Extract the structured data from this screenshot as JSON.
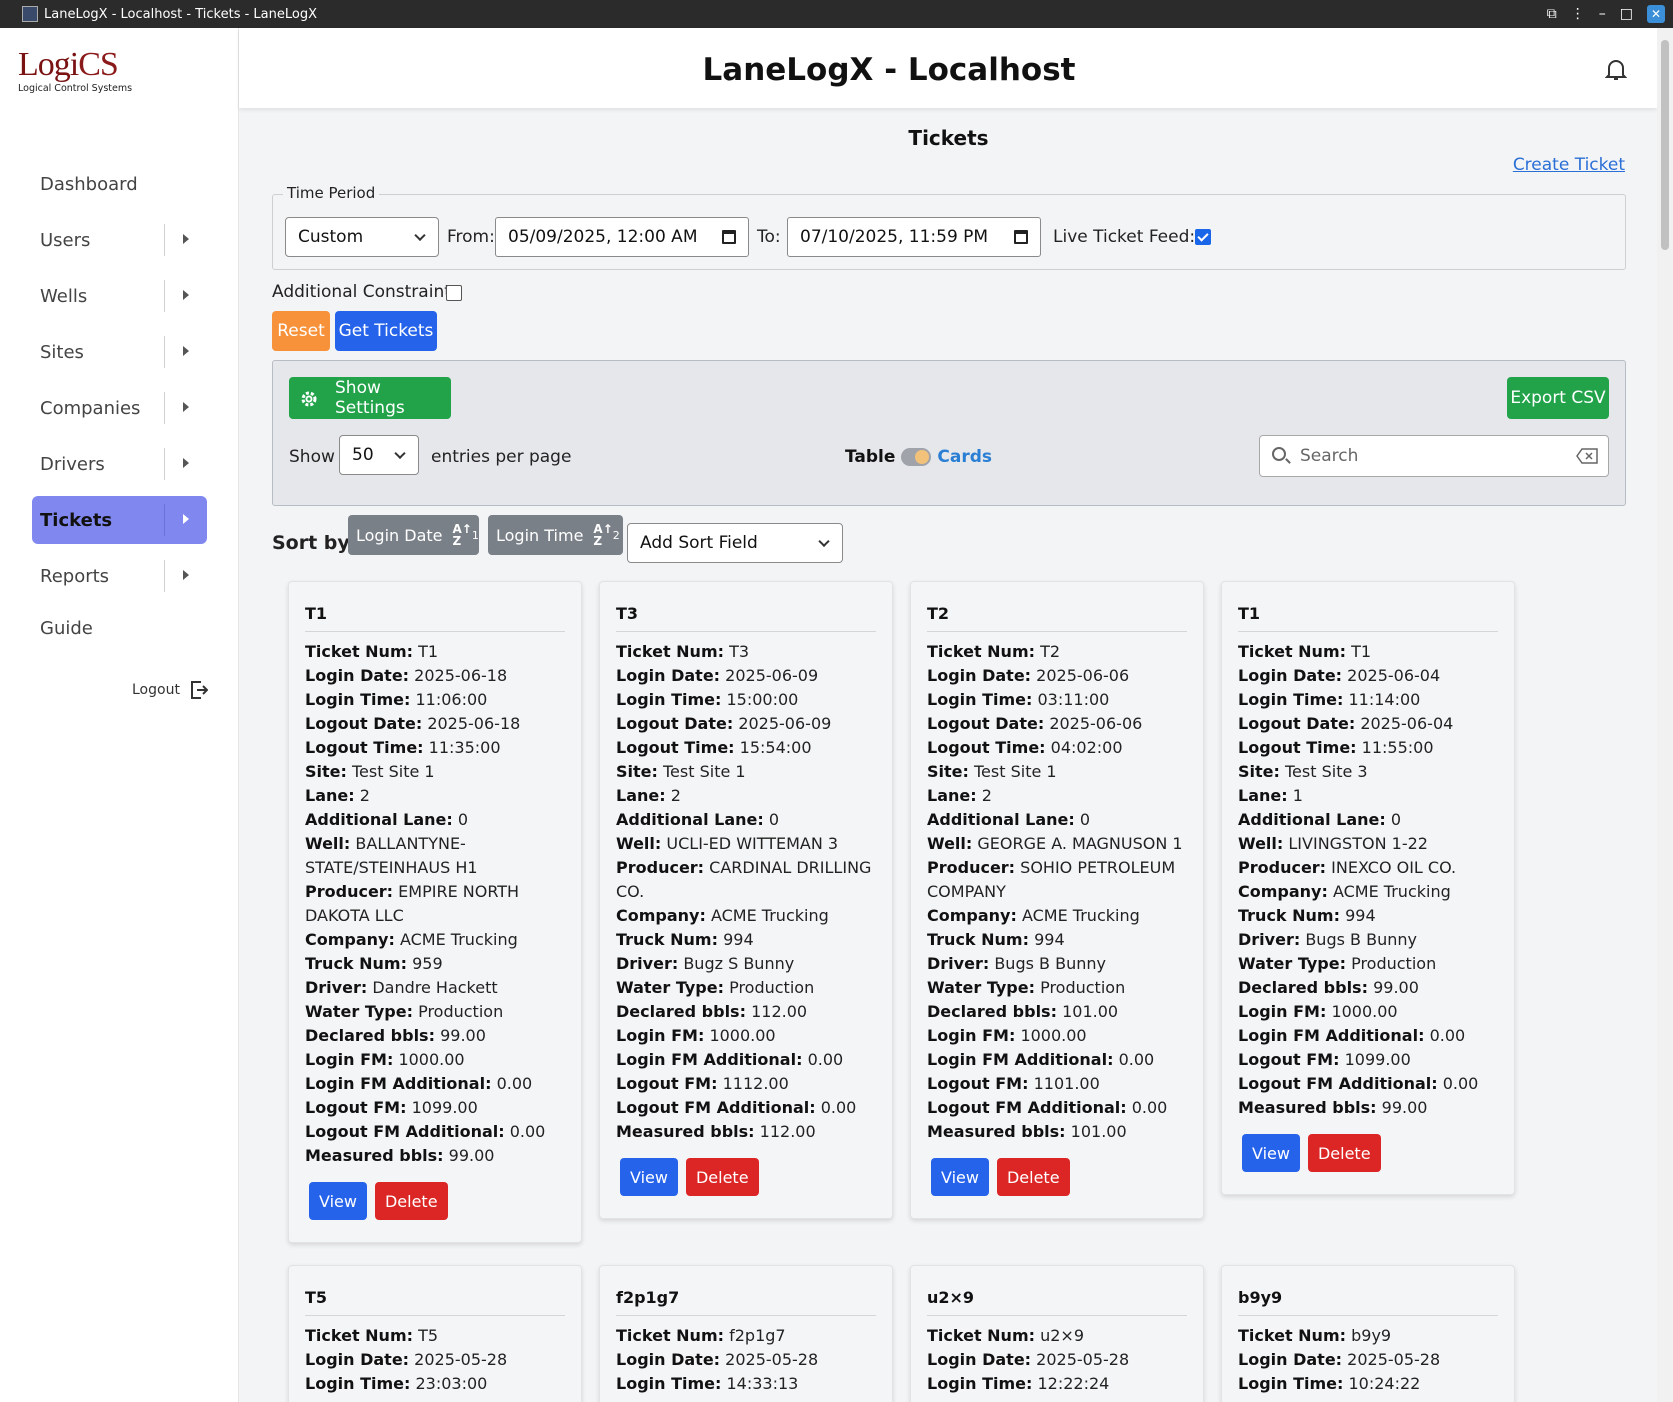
{
  "window": {
    "title": "LaneLogX - Localhost - Tickets - LaneLogX"
  },
  "logo": {
    "word1": "Logi",
    "word2": "CS",
    "sub": "Logical Control Systems"
  },
  "sidebar": {
    "items": [
      {
        "label": "Dashboard"
      },
      {
        "label": "Users"
      },
      {
        "label": "Wells"
      },
      {
        "label": "Sites"
      },
      {
        "label": "Companies"
      },
      {
        "label": "Drivers"
      },
      {
        "label": "Tickets"
      },
      {
        "label": "Reports"
      },
      {
        "label": "Guide"
      }
    ],
    "logout": "Logout"
  },
  "header": {
    "title": "LaneLogX - Localhost"
  },
  "page": {
    "title": "Tickets",
    "create_link": "Create Ticket"
  },
  "filters": {
    "legend": "Time Period",
    "period": "Custom",
    "from_label": "From:",
    "from_value": "05/09/2025, 12:00 AM",
    "to_label": "To:",
    "to_value": "07/10/2025, 11:59 PM",
    "live_label": "Live Ticket Feed:",
    "additional_label": "Additional Constraints",
    "reset": "Reset",
    "get": "Get Tickets"
  },
  "settings": {
    "show_settings": "Show Settings",
    "export": "Export CSV",
    "show_label": "Show",
    "entries": "50",
    "entries_label": "entries per page",
    "table_label": "Table",
    "cards_label": "Cards",
    "search_placeholder": "Search"
  },
  "sort": {
    "label": "Sort by:",
    "chip1": "Login Date",
    "chip1_icon_top": "A",
    "chip1_icon_bot": "Z",
    "chip1_num": "1",
    "chip2": "Login Time",
    "chip2_num": "2",
    "add": "Add Sort Field"
  },
  "labels": {
    "ticket_num": "Ticket Num:",
    "login_date": "Login Date:",
    "login_time": "Login Time:",
    "logout_date": "Logout Date:",
    "logout_time": "Logout Time:",
    "site": "Site:",
    "lane": "Lane:",
    "additional_lane": "Additional Lane:",
    "well": "Well:",
    "producer": "Producer:",
    "company": "Company:",
    "truck_num": "Truck Num:",
    "driver": "Driver:",
    "water_type": "Water Type:",
    "declared": "Declared bbls:",
    "login_fm": "Login FM:",
    "login_fm_add": "Login FM Additional:",
    "logout_fm": "Logout FM:",
    "logout_fm_add": "Logout FM Additional:",
    "measured": "Measured bbls:",
    "view": "View",
    "delete": "Delete"
  },
  "cards": [
    {
      "title": "T1",
      "ticket_num": "T1",
      "login_date": "2025-06-18",
      "login_time": "11:06:00",
      "logout_date": "2025-06-18",
      "logout_time": "11:35:00",
      "site": "Test Site 1",
      "lane": "2",
      "additional_lane": "0",
      "well": "BALLANTYNE-STATE/STEINHAUS H1",
      "producer": "EMPIRE NORTH DAKOTA LLC",
      "company": "ACME Trucking",
      "truck_num": "959",
      "driver": "Dandre Hackett",
      "water_type": "Production",
      "declared": "99.00",
      "login_fm": "1000.00",
      "login_fm_add": "0.00",
      "logout_fm": "1099.00",
      "logout_fm_add": "0.00",
      "measured": "99.00"
    },
    {
      "title": "T3",
      "ticket_num": "T3",
      "login_date": "2025-06-09",
      "login_time": "15:00:00",
      "logout_date": "2025-06-09",
      "logout_time": "15:54:00",
      "site": "Test Site 1",
      "lane": "2",
      "additional_lane": "0",
      "well": "UCLI-ED WITTEMAN 3",
      "producer": "CARDINAL DRILLING CO.",
      "company": "ACME Trucking",
      "truck_num": "994",
      "driver": "Bugz S Bunny",
      "water_type": "Production",
      "declared": "112.00",
      "login_fm": "1000.00",
      "login_fm_add": "0.00",
      "logout_fm": "1112.00",
      "logout_fm_add": "0.00",
      "measured": "112.00"
    },
    {
      "title": "T2",
      "ticket_num": "T2",
      "login_date": "2025-06-06",
      "login_time": "03:11:00",
      "logout_date": "2025-06-06",
      "logout_time": "04:02:00",
      "site": "Test Site 1",
      "lane": "2",
      "additional_lane": "0",
      "well": "GEORGE A. MAGNUSON 1",
      "producer": "SOHIO PETROLEUM COMPANY",
      "company": "ACME Trucking",
      "truck_num": "994",
      "driver": "Bugs B Bunny",
      "water_type": "Production",
      "declared": "101.00",
      "login_fm": "1000.00",
      "login_fm_add": "0.00",
      "logout_fm": "1101.00",
      "logout_fm_add": "0.00",
      "measured": "101.00"
    },
    {
      "title": "T1",
      "ticket_num": "T1",
      "login_date": "2025-06-04",
      "login_time": "11:14:00",
      "logout_date": "2025-06-04",
      "logout_time": "11:55:00",
      "site": "Test Site 3",
      "lane": "1",
      "additional_lane": "0",
      "well": "LIVINGSTON 1-22",
      "producer": "INEXCO OIL CO.",
      "company": "ACME Trucking",
      "truck_num": "994",
      "driver": "Bugs B Bunny",
      "water_type": "Production",
      "declared": "99.00",
      "login_fm": "1000.00",
      "login_fm_add": "0.00",
      "logout_fm": "1099.00",
      "logout_fm_add": "0.00",
      "measured": "99.00"
    },
    {
      "title": "T5",
      "ticket_num": "T5",
      "login_date": "2025-05-28",
      "login_time": "23:03:00"
    },
    {
      "title": "f2p1g7",
      "ticket_num": "f2p1g7",
      "login_date": "2025-05-28",
      "login_time": "14:33:13"
    },
    {
      "title": "u2×9",
      "ticket_num": "u2×9",
      "login_date": "2025-05-28",
      "login_time": "12:22:24"
    },
    {
      "title": "b9y9",
      "ticket_num": "b9y9",
      "login_date": "2025-05-28",
      "login_time": "10:24:22"
    }
  ]
}
